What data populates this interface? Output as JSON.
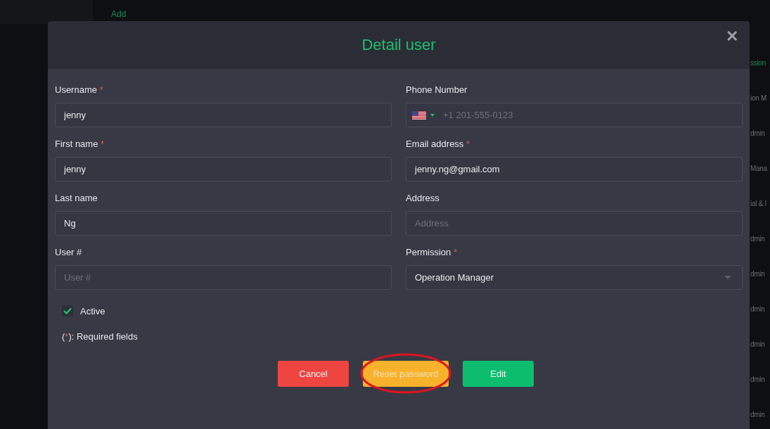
{
  "background": {
    "link": "Add",
    "column_texts": [
      {
        "text": "ssion",
        "selected": true
      },
      {
        "text": "ion M",
        "selected": false
      },
      {
        "text": "dmin",
        "selected": false
      },
      {
        "text": "Mana",
        "selected": false
      },
      {
        "text": "ial & I",
        "selected": false
      },
      {
        "text": "dmin",
        "selected": false
      },
      {
        "text": "dmin",
        "selected": false
      },
      {
        "text": "dmin",
        "selected": false
      },
      {
        "text": "dmin",
        "selected": false
      },
      {
        "text": "dmin",
        "selected": false
      },
      {
        "text": "dmin",
        "selected": false
      }
    ]
  },
  "dialog": {
    "title": "Detail user",
    "close": "✕",
    "fields": [
      {
        "kind": "text",
        "label": "Username",
        "required": true,
        "value": "jenny"
      },
      {
        "kind": "phone",
        "label": "Phone Number",
        "required": false,
        "placeholder": "+1 201-555-0123"
      },
      {
        "kind": "text",
        "label": "First name",
        "required": true,
        "value": "jenny"
      },
      {
        "kind": "text",
        "label": "Email address",
        "required": true,
        "value": "jenny.ng@gmail.com"
      },
      {
        "kind": "text",
        "label": "Last name",
        "required": false,
        "value": "Ng"
      },
      {
        "kind": "text",
        "label": "Address",
        "required": false,
        "placeholder": "Address"
      },
      {
        "kind": "text",
        "label": "User #",
        "required": false,
        "placeholder": "User #"
      },
      {
        "kind": "select",
        "label": "Permission",
        "required": true,
        "value": "Operation Manager"
      }
    ],
    "active": {
      "label": "Active",
      "checked": true
    },
    "note": {
      "open": "(",
      "mark": "*",
      "rest": "): Required fields"
    },
    "buttons": [
      {
        "kind": "danger",
        "label": "Cancel",
        "circled": false
      },
      {
        "kind": "warning",
        "label": "Reset password",
        "circled": true
      },
      {
        "kind": "success",
        "label": "Edit",
        "circled": false
      }
    ]
  }
}
